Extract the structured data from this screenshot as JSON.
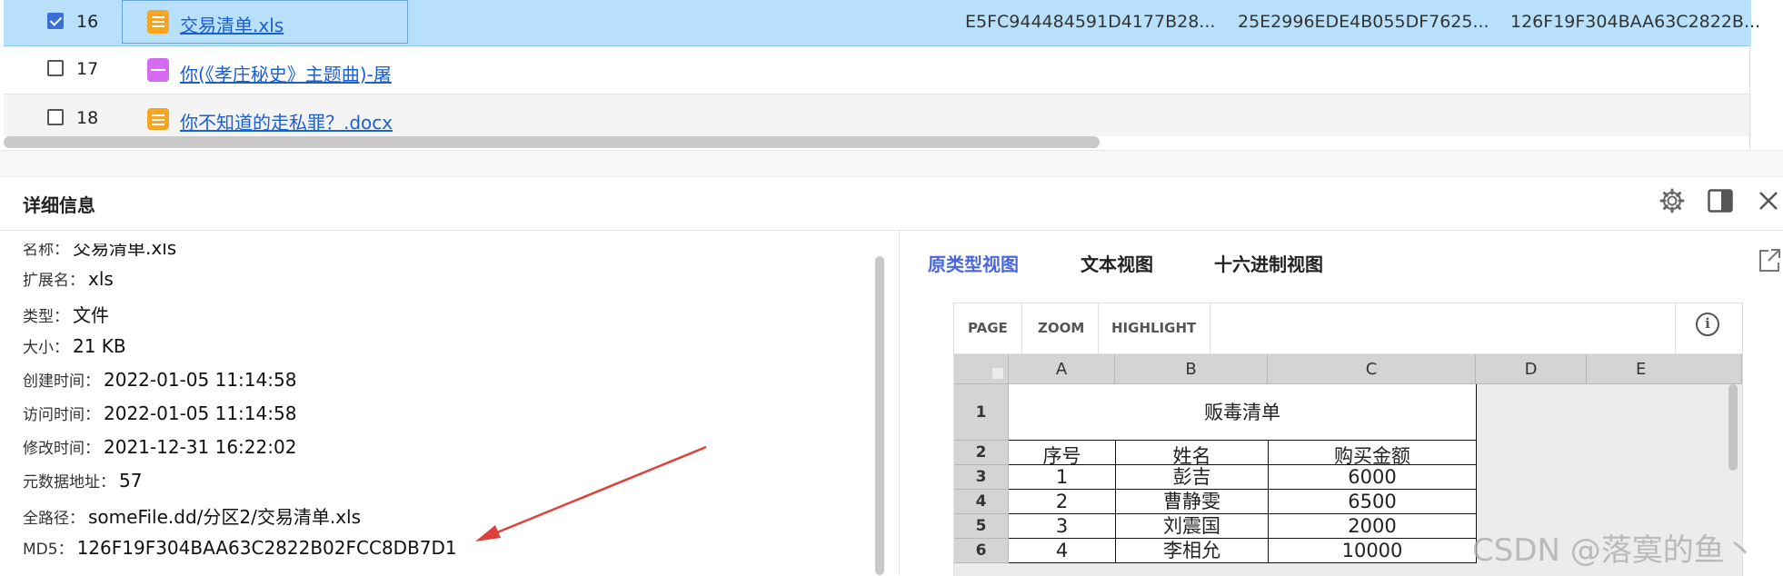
{
  "table": {
    "rows": [
      {
        "index": "16",
        "checked": true,
        "name": "交易清单.xls",
        "icon": "spreadsheet-file-icon",
        "hash1": "E5FC944484591D4177B28...",
        "hash2": "25E2996EDE4B055DF7625...",
        "hash3": "126F19F304BAA63C2822B..."
      },
      {
        "index": "17",
        "checked": false,
        "name": "你(《孝庄秘史》主题曲)-屠",
        "icon": "audio-file-icon"
      },
      {
        "index": "18",
        "checked": false,
        "name": "你不知道的走私罪？.docx",
        "icon": "document-file-icon"
      }
    ]
  },
  "details": {
    "title": "详细信息",
    "fields": [
      {
        "key": "名称：",
        "value": "交易清单.xls"
      },
      {
        "key": "扩展名：",
        "value": "xls"
      },
      {
        "key": "类型：",
        "value": "文件"
      },
      {
        "key": "大小：",
        "value": "21 KB"
      },
      {
        "key": "创建时间：",
        "value": "2022-01-05 11:14:58"
      },
      {
        "key": "访问时间：",
        "value": "2022-01-05 11:14:58"
      },
      {
        "key": "修改时间：",
        "value": "2021-12-31 16:22:02"
      },
      {
        "key": "元数据地址：",
        "value": "57"
      },
      {
        "key": "全路径：",
        "value": "someFile.dd/分区2/交易清单.xls"
      },
      {
        "key": "MD5：",
        "value": "126F19F304BAA63C2822B02FCC8DB7D1"
      }
    ]
  },
  "preview": {
    "tabs": [
      "原类型视图",
      "文本视图",
      "十六进制视图"
    ],
    "active_tab": "原类型视图",
    "toolbar": [
      "PAGE",
      "ZOOM",
      "HIGHLIGHT"
    ],
    "columns": [
      "A",
      "B",
      "C",
      "D",
      "E"
    ],
    "rows": [
      "1",
      "2",
      "3",
      "4",
      "5",
      "6"
    ],
    "sheet_title": "贩毒清单",
    "headers": [
      "序号",
      "姓名",
      "购买金额"
    ],
    "data": [
      [
        "1",
        "彭吉",
        "6000"
      ],
      [
        "2",
        "曹静雯",
        "6500"
      ],
      [
        "3",
        "刘震国",
        "2000"
      ],
      [
        "4",
        "李相允",
        "10000"
      ]
    ]
  },
  "watermark": "CSDN @落寞的鱼丶",
  "colors": {
    "selected_row": "#b9e0fb",
    "link": "#1a5fd6",
    "active_tab": "#4a66e0",
    "arrow": "#e0403a"
  }
}
